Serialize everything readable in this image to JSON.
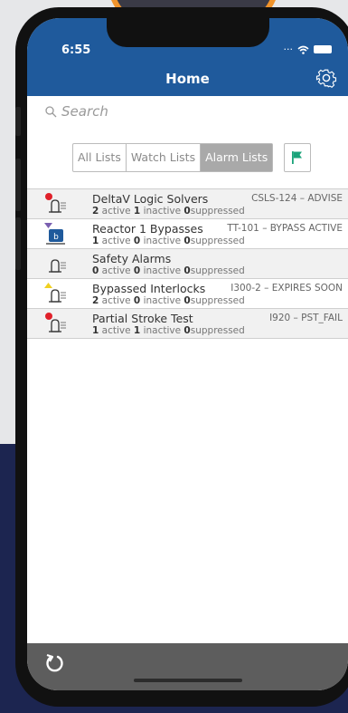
{
  "status_bar": {
    "time": "6:55"
  },
  "header": {
    "title": "Home"
  },
  "search": {
    "placeholder": "Search"
  },
  "tabs": [
    {
      "label": "All Lists"
    },
    {
      "label": "Watch Lists"
    },
    {
      "label": "Alarm Lists"
    }
  ],
  "labels": {
    "active": "active",
    "inactive": "inactive",
    "suppressed": "suppressed"
  },
  "rows": [
    {
      "name": "DeltaV Logic Solvers",
      "tag": "CSLS-124 – ADVISE",
      "active": "2",
      "inactive": "1",
      "suppressed": "0"
    },
    {
      "name": "Reactor 1 Bypasses",
      "tag": "TT-101 – BYPASS ACTIVE",
      "active": "1",
      "inactive": "0",
      "suppressed": "0"
    },
    {
      "name": "Safety Alarms",
      "tag": "",
      "active": "0",
      "inactive": "0",
      "suppressed": "0"
    },
    {
      "name": "Bypassed Interlocks",
      "tag": "I300-2 – EXPIRES SOON",
      "active": "2",
      "inactive": "0",
      "suppressed": "0"
    },
    {
      "name": "Partial Stroke Test",
      "tag": "I920 – PST_FAIL",
      "active": "1",
      "inactive": "1",
      "suppressed": "0"
    }
  ],
  "colors": {
    "header": "#1f5a9c",
    "accent_flag": "#1aa37a",
    "alarm_red": "#e0202a",
    "bypass_purple": "#7a5fb0",
    "warn_yellow": "#f0d020"
  }
}
